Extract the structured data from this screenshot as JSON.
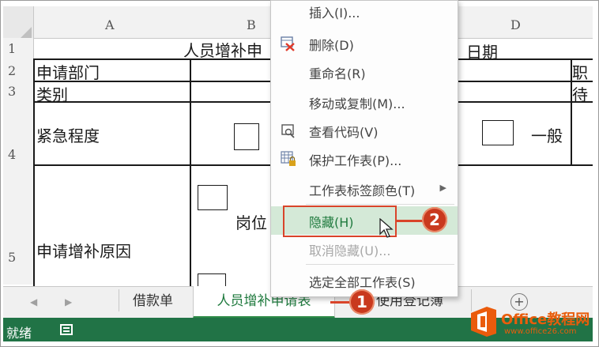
{
  "columns": [
    "A",
    "B",
    "D"
  ],
  "rows": [
    "1",
    "2",
    "3",
    "4",
    "5"
  ],
  "cells": {
    "b1_title": "人员增补申",
    "d1_date": "日期",
    "a2": "申请部门",
    "a3": "类别",
    "a4": "紧急程度",
    "d4": "一般",
    "a5": "申请增补原因",
    "b5": "岗位",
    "e2_partial": "职",
    "e3_partial": "待"
  },
  "context_menu": {
    "items": [
      {
        "label": "插入(I)...",
        "disabled": false,
        "icon": ""
      },
      {
        "label": "删除(D)",
        "disabled": false,
        "icon": "delete-sheet-icon"
      },
      {
        "label": "重命名(R)",
        "disabled": false,
        "icon": ""
      },
      {
        "label": "移动或复制(M)...",
        "disabled": false,
        "icon": ""
      },
      {
        "label": "查看代码(V)",
        "disabled": false,
        "icon": "view-code-icon"
      },
      {
        "label": "保护工作表(P)...",
        "disabled": false,
        "icon": "protect-sheet-icon"
      },
      {
        "label": "工作表标签颜色(T)",
        "disabled": false,
        "icon": "",
        "submenu": true
      },
      {
        "label": "隐藏(H)",
        "disabled": false,
        "icon": "",
        "highlighted": true
      },
      {
        "label": "取消隐藏(U)...",
        "disabled": true,
        "icon": ""
      },
      {
        "label": "选定全部工作表(S)",
        "disabled": false,
        "icon": ""
      }
    ]
  },
  "sheet_tabs": [
    {
      "label": "借款单",
      "active": false
    },
    {
      "label": "人员增补申请表",
      "active": true
    },
    {
      "label": "使用登记簿",
      "active": false
    }
  ],
  "status_bar": {
    "text": "就绪"
  },
  "callouts": [
    "1",
    "2"
  ],
  "watermark": {
    "brand": "Office教程网",
    "url": "www.office26.com"
  },
  "colors": {
    "accent_green": "#217346",
    "callout_red": "#c9391e",
    "highlight": "#d4e9d7"
  }
}
